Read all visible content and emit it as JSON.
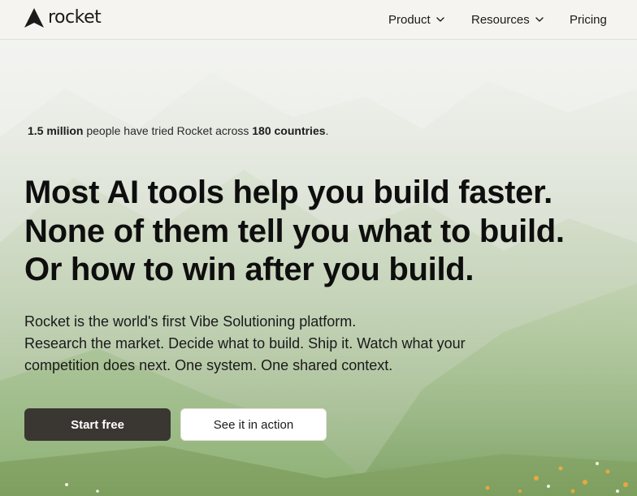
{
  "brand": {
    "name": "rocket",
    "logo_icon": "rocket-logo-mark"
  },
  "nav": {
    "items": [
      {
        "label": "Product",
        "has_dropdown": true
      },
      {
        "label": "Resources",
        "has_dropdown": true
      },
      {
        "label": "Pricing",
        "has_dropdown": false
      }
    ]
  },
  "hero": {
    "stats": {
      "users": "1.5 million",
      "middle": " people have tried Rocket across ",
      "countries": "180 countries",
      "end": "."
    },
    "headline": [
      "Most AI tools help you build faster.",
      "None of them tell you what to build.",
      "Or how to win after you build."
    ],
    "subtext": [
      "Rocket is the world's first Vibe Solutioning platform.",
      "Research the market. Decide what to build. Ship it. Watch what your",
      "competition does next. One system. One shared context."
    ],
    "cta_primary": "Start free",
    "cta_secondary": "See it in action"
  },
  "colors": {
    "nav_bg": "#f5f4f0",
    "primary_button": "#3a3632",
    "text": "#141414"
  }
}
